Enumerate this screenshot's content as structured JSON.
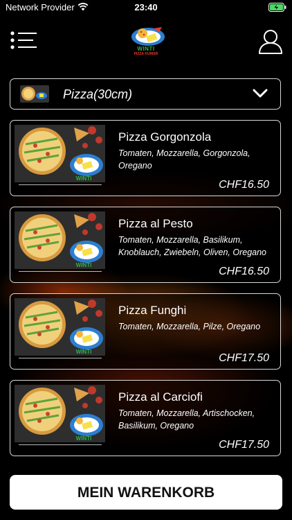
{
  "status_bar": {
    "carrier": "Network Provider",
    "time": "23:40"
  },
  "header": {
    "logo_text": "WINTI",
    "logo_subtext": "PIZZA KURIER",
    "menu_icon": "hamburger-menu-icon",
    "user_icon": "user-profile-icon"
  },
  "category": {
    "selected": "Pizza(30cm)",
    "chevron_icon": "chevron-down-icon"
  },
  "products": [
    {
      "name": "Pizza Gorgonzola",
      "description": "Tomaten, Mozzarella, Gorgonzola, Oregano",
      "price": "CHF16.50"
    },
    {
      "name": "Pizza al Pesto",
      "description": "Tomaten, Mozzarella, Basilikum, Knoblauch, Zwiebeln, Oliven, Oregano",
      "price": "CHF16.50"
    },
    {
      "name": "Pizza Funghi",
      "description": "Tomaten, Mozzarella, Pilze, Oregano",
      "price": "CHF17.50"
    },
    {
      "name": "Pizza al Carciofi",
      "description": "Tomaten, Mozzarella, Artischocken, Basilikum, Oregano",
      "price": "CHF17.50"
    }
  ],
  "cart_button": {
    "label": "MEIN WARENKORB"
  },
  "colors": {
    "background": "#000000",
    "border": "#d9d9d9",
    "button_bg": "#ffffff",
    "battery": "#4cd964"
  }
}
